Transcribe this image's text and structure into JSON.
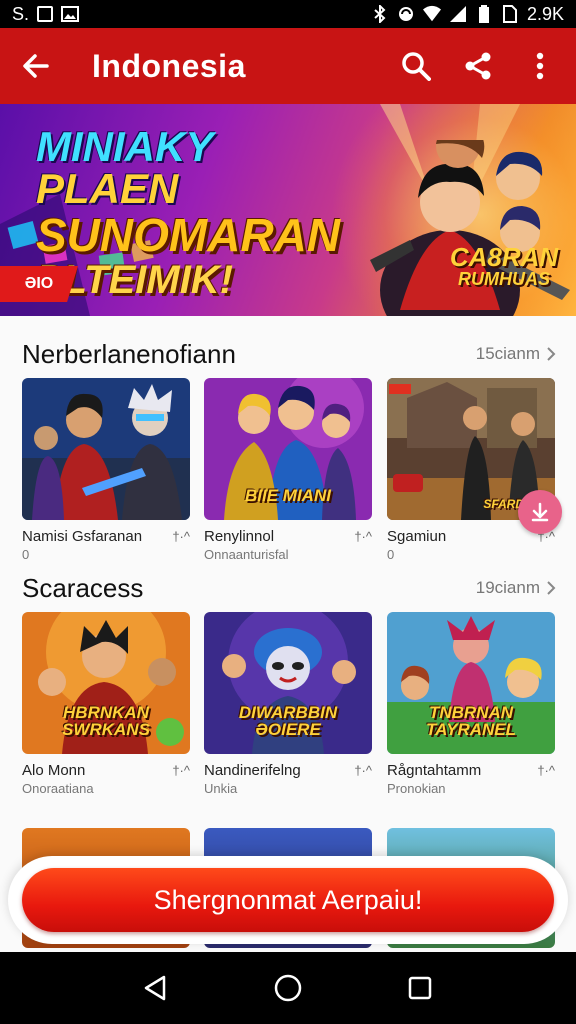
{
  "status_bar": {
    "left_text": "S.",
    "right_text": "2.9K"
  },
  "app_bar": {
    "title": "Indonesia"
  },
  "banner": {
    "headline_line1_a": "MINIAKY",
    "headline_line1_b": "PLAEN",
    "headline_line2": "SUNOMARAN",
    "headline_line3": "PLTEIMIK!",
    "ribbon": "ƏIO",
    "promo_line1": "CA8RAN",
    "promo_line2": "RUMHUAS"
  },
  "sections": [
    {
      "title": "Nerberlanenofiann",
      "more": "15cianm",
      "cards": [
        {
          "name": "Namisi Gsfaranan",
          "sub": "0",
          "rating": "†·^",
          "thumb_label": ""
        },
        {
          "name": "Renylinnol",
          "sub": "Onnaanturisfal",
          "rating": "†·^",
          "thumb_label": "BIIE MIANI"
        },
        {
          "name": "Sgamiun",
          "sub": "0",
          "rating": "†·^",
          "thumb_label": "SFARDA"
        }
      ]
    },
    {
      "title": "Scaracess",
      "more": "19cianm",
      "cards": [
        {
          "name": "Alo Monn",
          "sub": "Onoraatiana",
          "rating": "†·^",
          "thumb_label": "HBRNKAN SWRKANS"
        },
        {
          "name": "Nandinerifelng",
          "sub": "Unkia",
          "rating": "†·^",
          "thumb_label": "DIWARBBIN ƏOIERE"
        },
        {
          "name": "Rågntahtamm",
          "sub": "Pronokian",
          "rating": "†·^",
          "thumb_label": "TNBRNAN TAYRANEL"
        }
      ]
    }
  ],
  "cta": {
    "label": "Shergnonmat Aerpaiu!"
  },
  "colors": {
    "app_bar": "#c81414",
    "cta": "#e8180e",
    "fab": "#e8638a"
  },
  "icons": [
    "back-arrow-icon",
    "search-icon",
    "share-icon",
    "more-vert-icon",
    "chevron-right-icon",
    "download-icon",
    "nav-back-icon",
    "nav-home-icon",
    "nav-recents-icon"
  ]
}
